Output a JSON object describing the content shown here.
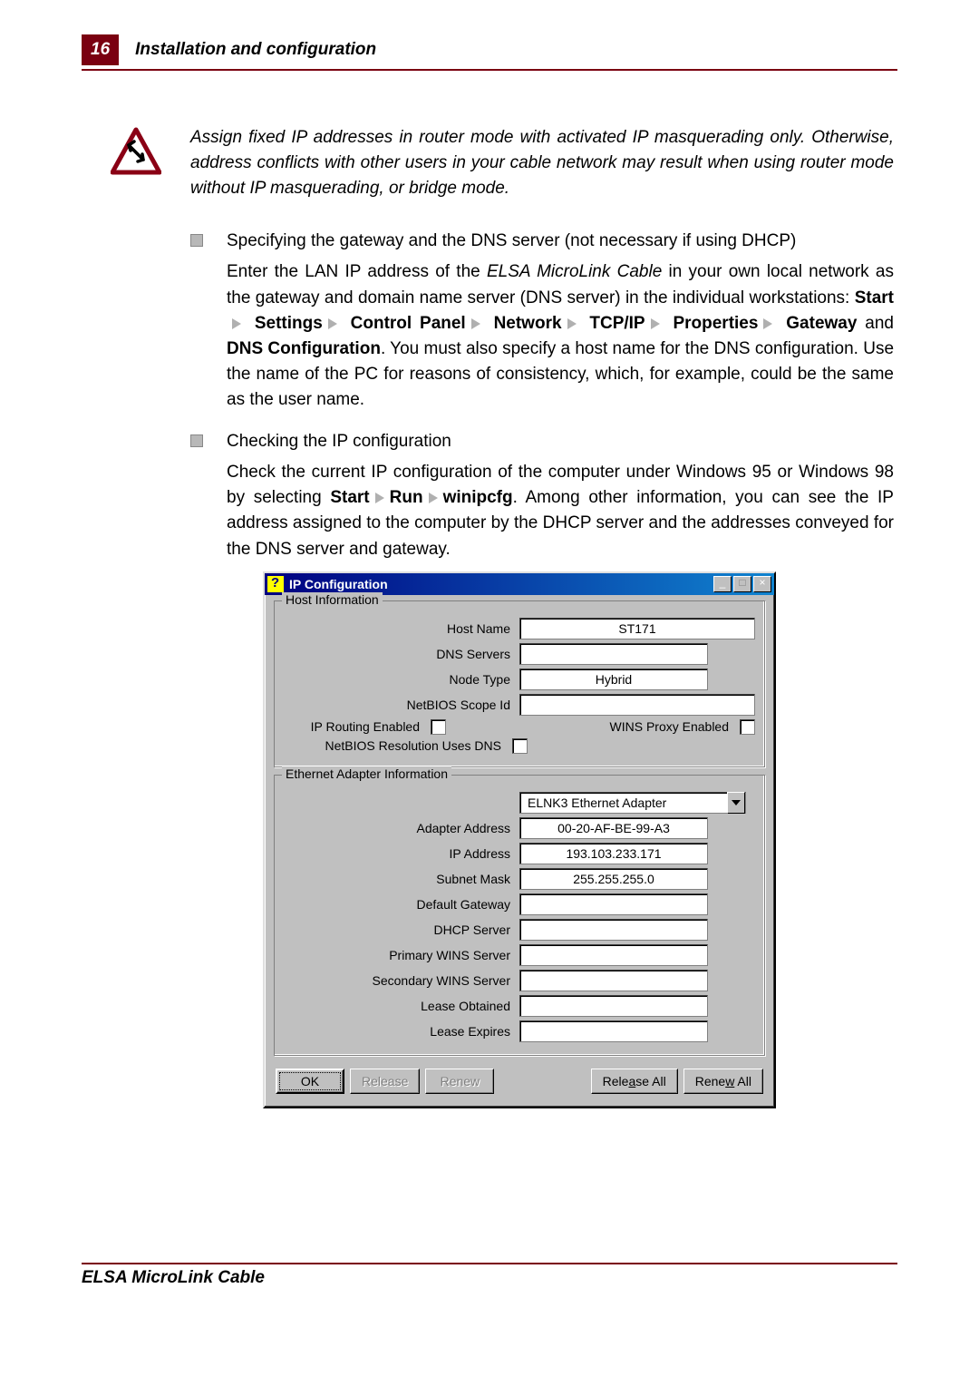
{
  "header": {
    "page_number": "16",
    "section_title": "Installation and configuration"
  },
  "warning": {
    "text": "Assign fixed IP addresses in router mode with activated IP masquerading only. Otherwise, address conflicts with other users in your cable network may result when using router mode without IP masquerading, or bridge mode."
  },
  "bullet1": {
    "title": "Specifying the gateway and the DNS server (not necessary if using DHCP)",
    "lead": "Enter the LAN IP address of the ",
    "product": "ELSA MicroLink Cable",
    "lead2": " in your own local network as the gateway and domain name server (DNS server) in the individual workstations: ",
    "nav": {
      "start": "Start",
      "settings": "Settings",
      "control_panel": "Control Panel",
      "network": "Network",
      "tcpip": "TCP/IP",
      "properties": "Properties",
      "gateway": "Gateway",
      "and": " and ",
      "dns_config": "DNS Configuration"
    },
    "tail": ".  You must also specify a host name for the DNS configuration.  Use the name of the PC for reasons of consistency, which, for example, could be the same as the user name."
  },
  "bullet2": {
    "title": "Checking the IP configuration",
    "text1": "Check the current IP configuration of the computer under Windows 95 or Windows 98 by selecting ",
    "start": "Start",
    "run": "Run",
    "cmd": "winipcfg",
    "text2": ".  Among other information, you can see the IP address assigned to the computer by the DHCP server and the addresses conveyed for the DNS server and gateway."
  },
  "dialog": {
    "title": "IP Configuration",
    "host_info_legend": "Host Information",
    "labels": {
      "host_name": "Host Name",
      "dns_servers": "DNS Servers",
      "node_type": "Node Type",
      "netbios_scope": "NetBIOS Scope Id",
      "ip_routing": "IP Routing Enabled",
      "wins_proxy": "WINS Proxy Enabled",
      "netbios_dns": "NetBIOS Resolution Uses DNS"
    },
    "values": {
      "host_name": "ST171",
      "dns_servers": "",
      "node_type": "Hybrid",
      "netbios_scope": ""
    },
    "adapter_legend": "Ethernet  Adapter Information",
    "adapter_dropdown": "ELNK3 Ethernet Adapter",
    "adapter_labels": {
      "adapter_address": "Adapter Address",
      "ip_address": "IP Address",
      "subnet_mask": "Subnet Mask",
      "default_gateway": "Default Gateway",
      "dhcp_server": "DHCP Server",
      "primary_wins": "Primary WINS Server",
      "secondary_wins": "Secondary WINS Server",
      "lease_obtained": "Lease Obtained",
      "lease_expires": "Lease Expires"
    },
    "adapter_values": {
      "adapter_address": "00-20-AF-BE-99-A3",
      "ip_address": "193.103.233.171",
      "subnet_mask": "255.255.255.0",
      "default_gateway": "",
      "dhcp_server": "",
      "primary_wins": "",
      "secondary_wins": "",
      "lease_obtained": "",
      "lease_expires": ""
    },
    "buttons": {
      "ok": "OK",
      "release": "Release",
      "renew": "Renew",
      "release_all_pre": "Rele",
      "release_all_u": "a",
      "release_all_post": "se All",
      "renew_all_pre": "Rene",
      "renew_all_u": "w",
      "renew_all_post": " All"
    }
  },
  "footer": {
    "product": "ELSA MicroLink Cable"
  }
}
